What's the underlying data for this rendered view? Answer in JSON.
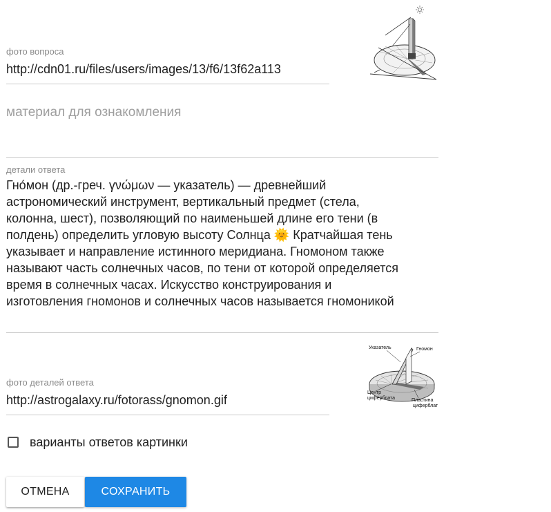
{
  "photo_question": {
    "label": "фото вопроса",
    "value": "http://cdn01.ru/files/users/images/13/f6/13f62a113"
  },
  "material": {
    "placeholder": "материал для ознакомления"
  },
  "answer_details": {
    "label": "детали ответа",
    "text": "Гно́мон (др.-греч. γνώμων — указатель) — древнейший\nастрономический инструмент, вертикальный предмет (стела,\nколонна, шест), позволяющий по наименьшей длине его тени (в\nполдень) определить угловую высоту Солнца 🌞 Кратчайшая тень\nуказывает и направление истинного меридиана. Гномоном также\nназывают часть солнечных часов, по тени от которой определяется\nвремя в солнечных часах. Искусство конструирования и\nизготовления гномонов и солнечных часов называется гномоникой"
  },
  "photo_answer": {
    "label": "фото деталей ответа",
    "value": "http://astrogalaxy.ru/fotorass/gnomon.gif"
  },
  "diagram_labels": {
    "pointer": "Указатель",
    "gnomon": "Гномон",
    "center_line1": "Центр",
    "center_line2": "циферблата",
    "plate_line1": "Пластина",
    "plate_line2": "циферблата"
  },
  "checkbox": {
    "label": "варианты ответов картинки",
    "checked": false
  },
  "buttons": {
    "cancel": "ОТМЕНА",
    "save": "СОХРАНИТЬ"
  },
  "colors": {
    "accent": "#1e88e5",
    "label": "#8a8a8a",
    "underline": "#c9c9c9"
  }
}
